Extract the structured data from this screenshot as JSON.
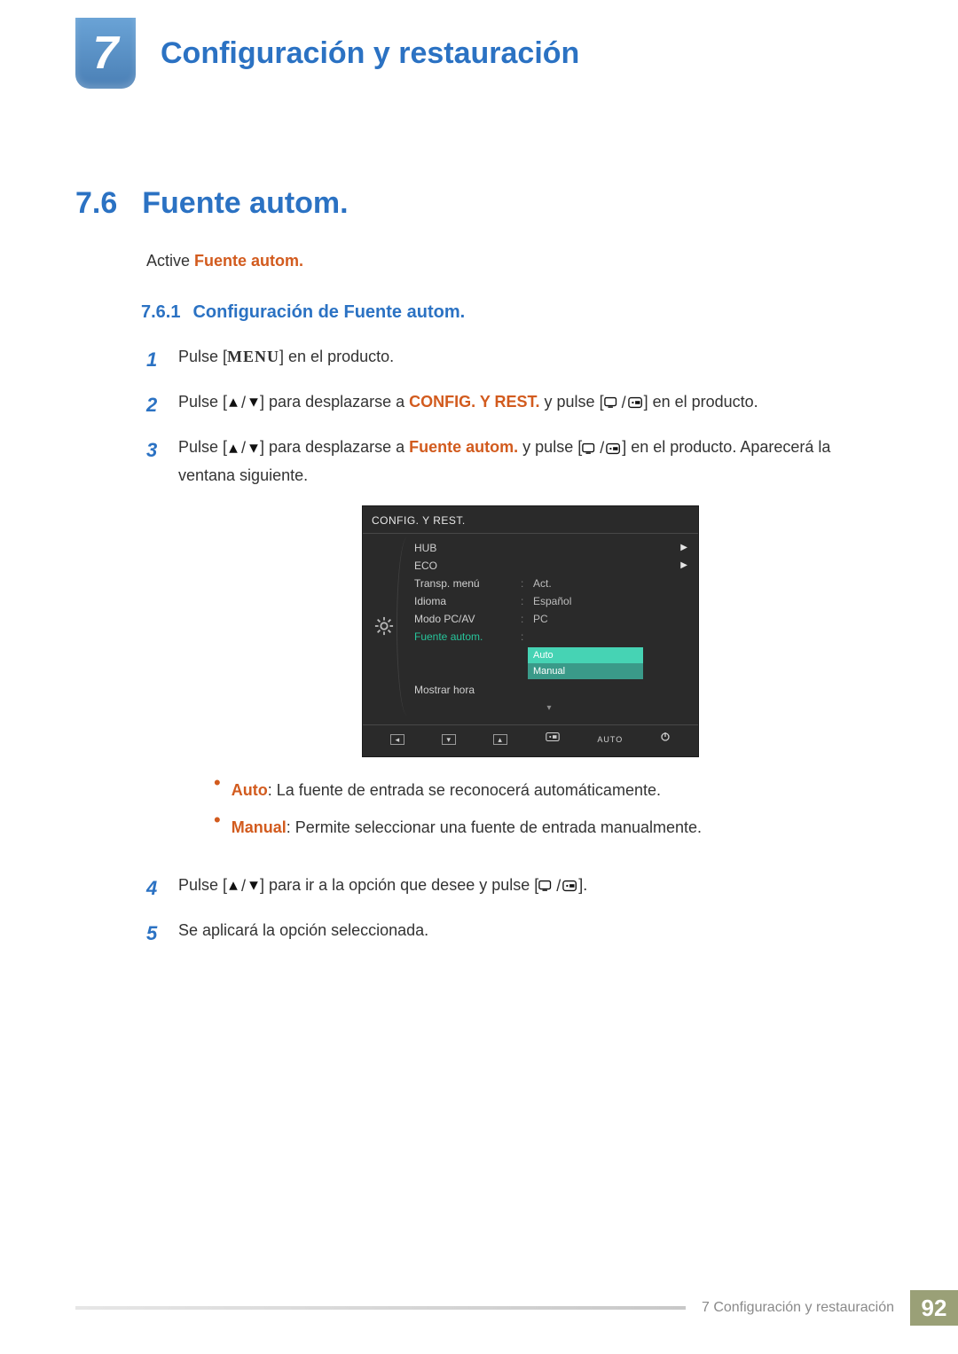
{
  "chapter": {
    "number": "7",
    "title": "Configuración y restauración"
  },
  "section": {
    "number": "7.6",
    "title": "Fuente autom."
  },
  "intro": {
    "pre": "Active ",
    "accent": "Fuente autom."
  },
  "subsection": {
    "number": "7.6.1",
    "title": "Configuración de Fuente autom."
  },
  "buttons": {
    "menu": "MENU"
  },
  "steps": {
    "s1": {
      "num": "1",
      "pre": "Pulse [",
      "post": "] en el producto."
    },
    "s2": {
      "num": "2",
      "a": "Pulse [",
      "b": "] para desplazarse a ",
      "accent": "CONFIG. Y REST.",
      "c": " y pulse [",
      "d": "] en el producto."
    },
    "s3": {
      "num": "3",
      "a": "Pulse [",
      "b": "] para desplazarse a ",
      "accent": "Fuente autom.",
      "c": " y pulse [",
      "d": "] en el producto. Aparecerá la ventana siguiente."
    },
    "s4": {
      "num": "4",
      "a": "Pulse [",
      "b": "] para ir a la opción que desee y pulse [",
      "c": "]."
    },
    "s5": {
      "num": "5",
      "a": "Se aplicará la opción seleccionada."
    }
  },
  "bullets": {
    "b1": {
      "accent": "Auto",
      "text": ": La fuente de entrada se reconocerá automáticamente."
    },
    "b2": {
      "accent": "Manual",
      "text": ": Permite seleccionar una fuente de entrada manualmente."
    }
  },
  "osd": {
    "title": "CONFIG. Y REST.",
    "rows": {
      "hub": "HUB",
      "eco": "ECO",
      "transp": "Transp. menú",
      "transp_val": "Act.",
      "idioma": "Idioma",
      "idioma_val": "Español",
      "pcav": "Modo PC/AV",
      "pcav_val": "PC",
      "fuente": "Fuente autom.",
      "mostrar": "Mostrar hora"
    },
    "options": {
      "auto": "Auto",
      "manual": "Manual"
    },
    "footer_auto": "AUTO"
  },
  "footer": {
    "label": "7 Configuración y restauración",
    "page": "92"
  },
  "chart_data": null
}
